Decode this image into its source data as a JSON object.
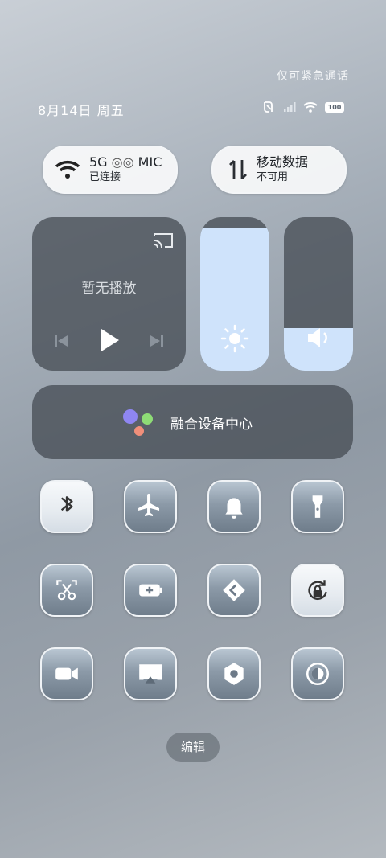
{
  "status_bar": {
    "emergency_text": "仅可紧急通话",
    "date_text": "8月14日 周五",
    "battery_text": "100",
    "icons": [
      "nfc-icon",
      "signal-icon",
      "wifi-icon",
      "battery-icon"
    ]
  },
  "wifi_pill": {
    "title": "5G",
    "title_suffix": "MIC",
    "subtitle": "已连接"
  },
  "mobile_pill": {
    "title": "移动数据",
    "subtitle": "不可用"
  },
  "media_card": {
    "status": "暂无播放"
  },
  "brightness": {
    "level": 0.93
  },
  "volume": {
    "level": 0.28
  },
  "fusion_center": {
    "label": "融合设备中心"
  },
  "quick_tiles": [
    {
      "name": "bluetooth-icon",
      "active": true
    },
    {
      "name": "airplane-icon",
      "active": false
    },
    {
      "name": "bell-icon",
      "active": false
    },
    {
      "name": "flashlight-icon",
      "active": false
    },
    {
      "name": "screenshot-icon",
      "active": false
    },
    {
      "name": "battery-saver-icon",
      "active": false
    },
    {
      "name": "nearby-share-icon",
      "active": false
    },
    {
      "name": "rotation-lock-icon",
      "active": true
    },
    {
      "name": "screen-record-icon",
      "active": false
    },
    {
      "name": "screen-cast-icon",
      "active": false
    },
    {
      "name": "settings-nut-icon",
      "active": false
    },
    {
      "name": "dark-mode-icon",
      "active": false
    }
  ],
  "edit_button": {
    "label": "编辑"
  },
  "colors": {
    "slider_fill": "#cfe3fb",
    "card_bg": "#4b5159"
  }
}
